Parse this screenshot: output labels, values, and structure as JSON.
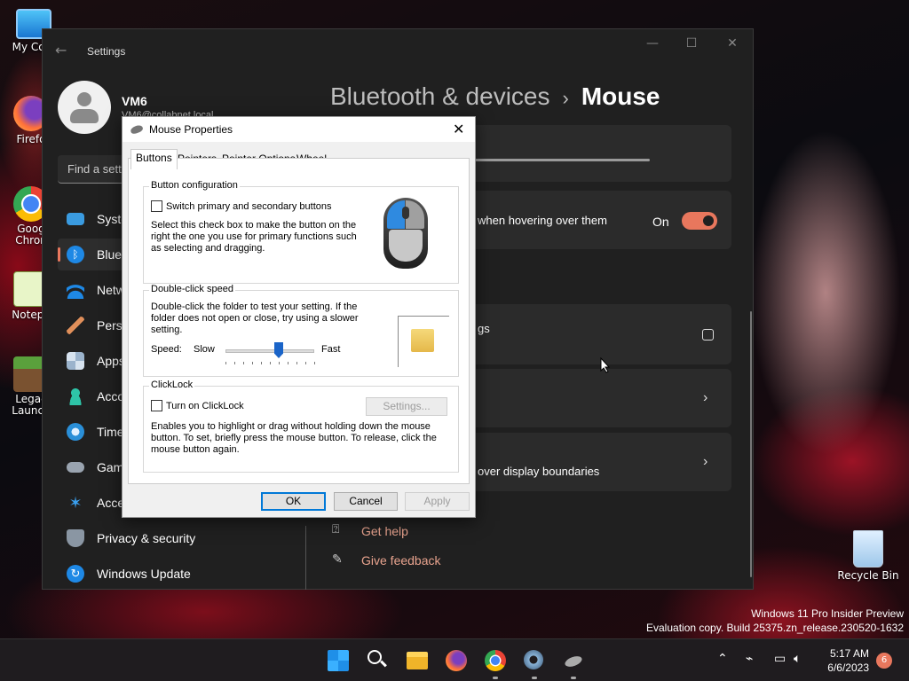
{
  "desktop": {
    "icons": [
      {
        "label": "My Com"
      },
      {
        "label": "Firefo"
      },
      {
        "label": "Goog Chron"
      },
      {
        "label": "Notepa"
      },
      {
        "label": "Legac Launch"
      },
      {
        "label": "Recycle Bin"
      }
    ],
    "watermark_line1": "Windows 11 Pro Insider Preview",
    "watermark_line2": "Evaluation copy. Build 25375.zn_release.230520-1632"
  },
  "settings": {
    "app_title": "Settings",
    "user_name": "VM6",
    "user_email": "VM6@collabnet.local",
    "search_placeholder": "Find a sett",
    "nav": [
      {
        "label": "Syste",
        "icon": "monitor-icon"
      },
      {
        "label": "Blueto",
        "icon": "bluetooth-icon",
        "active": true
      },
      {
        "label": "Netw",
        "icon": "wifi-icon"
      },
      {
        "label": "Perso",
        "icon": "brush-icon"
      },
      {
        "label": "Apps",
        "icon": "apps-icon"
      },
      {
        "label": "Acco",
        "icon": "person-icon"
      },
      {
        "label": "Time",
        "icon": "clock-icon"
      },
      {
        "label": "Gam",
        "icon": "gamepad-icon"
      },
      {
        "label": "Acce",
        "icon": "accessibility-icon"
      },
      {
        "label": "Privacy & security",
        "icon": "shield-icon"
      },
      {
        "label": "Windows Update",
        "icon": "update-icon"
      }
    ],
    "breadcrumb_parent": "Bluetooth & devices",
    "breadcrumb_sep": "›",
    "breadcrumb_current": "Mouse",
    "scroll_inactive_text": "when hovering over them",
    "toggle_label": "On",
    "additional_settings_text": "gs",
    "multi_display_text": "over display boundaries",
    "get_help": "Get help",
    "give_feedback": "Give feedback",
    "accent_color": "#e8775d"
  },
  "dialog": {
    "title": "Mouse Properties",
    "tabs": [
      "Buttons",
      "Pointers",
      "Pointer Options",
      "Wheel"
    ],
    "button_config": {
      "title": "Button configuration",
      "checkbox_label": "Switch primary and secondary buttons",
      "checked": false,
      "desc_1": "Select this check box to make the button on the",
      "desc_2": "right the one you use for primary functions such",
      "desc_3": "as selecting and dragging."
    },
    "double_click": {
      "title": "Double-click speed",
      "desc_1": "Double-click the folder to test your setting. If the",
      "desc_2": "folder does not open or close, try using a slower",
      "desc_3": "setting.",
      "speed_label": "Speed:",
      "slow_label": "Slow",
      "fast_label": "Fast",
      "speed_fraction": 0.6
    },
    "clicklock": {
      "title": "ClickLock",
      "checkbox_label": "Turn on ClickLock",
      "checked": false,
      "settings_button": "Settings...",
      "desc_1": "Enables you to highlight or drag without holding down the mouse",
      "desc_2": "button. To set, briefly press the mouse button. To release, click the",
      "desc_3": "mouse button again."
    },
    "ok": "OK",
    "cancel": "Cancel",
    "apply": "Apply"
  },
  "taskbar": {
    "apps": [
      "windows-start-icon",
      "search-icon",
      "file-explorer-icon",
      "firefox-icon",
      "chrome-icon",
      "settings-gear-icon",
      "mouse-app-icon"
    ],
    "time": "5:17 AM",
    "date": "6/6/2023",
    "notification_count": "6"
  }
}
